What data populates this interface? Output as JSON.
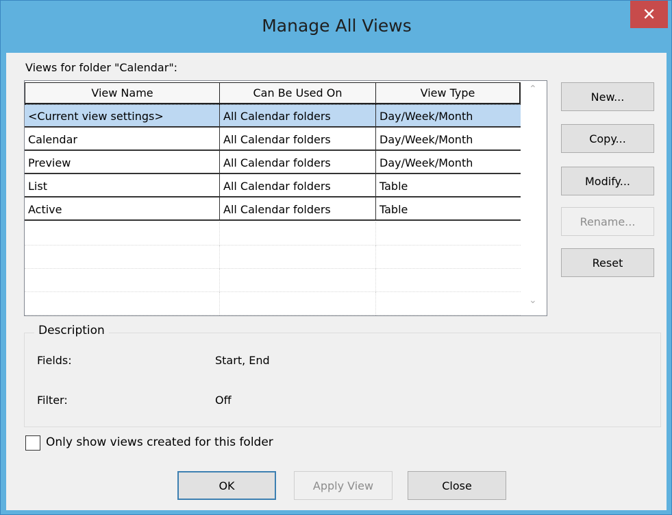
{
  "dialog": {
    "title": "Manage All Views",
    "close_glyph": "✕",
    "views_label": "Views for folder \"Calendar\":"
  },
  "table": {
    "headers": [
      "View Name",
      "Can Be Used On",
      "View Type"
    ],
    "rows": [
      [
        "<Current view settings>",
        "All Calendar folders",
        "Day/Week/Month"
      ],
      [
        "Calendar",
        "All Calendar folders",
        "Day/Week/Month"
      ],
      [
        "Preview",
        "All Calendar folders",
        "Day/Week/Month"
      ],
      [
        "List",
        "All Calendar folders",
        "Table"
      ],
      [
        "Active",
        "All Calendar folders",
        "Table"
      ]
    ],
    "selected_row": 0
  },
  "scroll": {
    "up_glyph": "⌃",
    "down_glyph": "⌄"
  },
  "side_buttons": {
    "new": "New...",
    "copy": "Copy...",
    "modify": "Modify...",
    "rename": "Rename...",
    "reset": "Reset"
  },
  "description": {
    "legend": "Description",
    "fields_label": "Fields:",
    "fields_value": "Start, End",
    "filter_label": "Filter:",
    "filter_value": "Off"
  },
  "checkbox": {
    "label": "Only show views created for this folder",
    "checked": false
  },
  "footer_buttons": {
    "ok": "OK",
    "apply_view": "Apply View",
    "close": "Close"
  },
  "colors": {
    "title_bar": "#5fb1de",
    "close_button": "#c74b4b",
    "selection": "#bdd8f2",
    "dialog_bg": "#f0f0f0"
  }
}
